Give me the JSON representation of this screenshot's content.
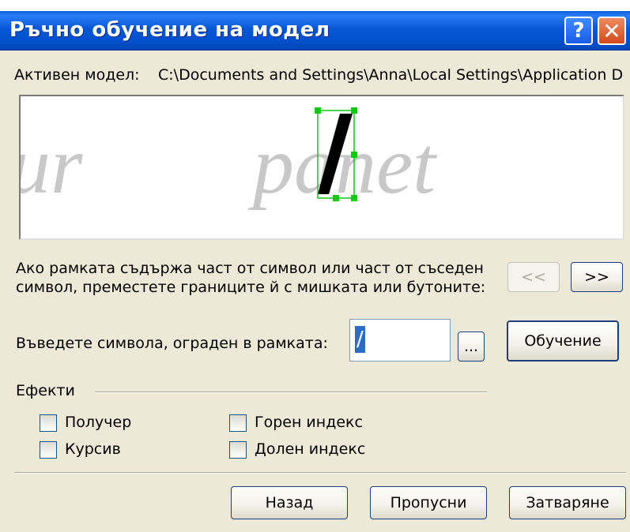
{
  "window": {
    "title": "Ръчно обучение на модел",
    "help_label": "?",
    "close_label": "✕"
  },
  "model": {
    "label": "Активен модел:",
    "path": "C:\\Documents and Settings\\Anna\\Local Settings\\Application D"
  },
  "preview": {
    "text_left": "ur",
    "text_right": "panet"
  },
  "hint": "Ако рамката съдържа част от символ или част от съседен символ, преместете границите й с мишката или бутоните:",
  "nav": {
    "prev_label": "<<",
    "next_label": ">>"
  },
  "char_entry": {
    "label": "Въведете символа, ограден в рамката:",
    "value": "/",
    "browse_label": "...",
    "train_label": "Обучение"
  },
  "effects": {
    "label": "Ефекти",
    "bold": "Получер",
    "italic": "Курсив",
    "superscript": "Горен индекс",
    "subscript": "Долен индекс"
  },
  "actions": {
    "back_label": "Назад",
    "skip_label": "Пропусни",
    "close_label": "Затваряне"
  }
}
